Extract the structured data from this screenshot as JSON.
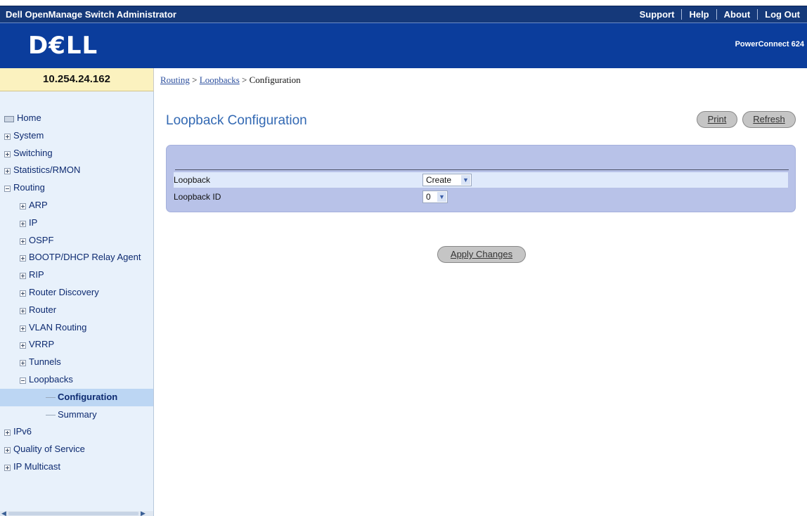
{
  "header": {
    "app_title": "Dell OpenManage Switch Administrator",
    "links": [
      "Support",
      "Help",
      "About",
      "Log Out"
    ],
    "logo_text": "D€LL",
    "product_text": "PowerConnect 624"
  },
  "sidebar": {
    "ip_address": "10.254.24.162",
    "items": [
      {
        "label": "Home"
      },
      {
        "label": "System"
      },
      {
        "label": "Switching"
      },
      {
        "label": "Statistics/RMON"
      },
      {
        "label": "Routing"
      },
      {
        "label": "ARP"
      },
      {
        "label": "IP"
      },
      {
        "label": "OSPF"
      },
      {
        "label": "BOOTP/DHCP Relay Agent"
      },
      {
        "label": "RIP"
      },
      {
        "label": "Router Discovery"
      },
      {
        "label": "Router"
      },
      {
        "label": "VLAN Routing"
      },
      {
        "label": "VRRP"
      },
      {
        "label": "Tunnels"
      },
      {
        "label": "Loopbacks"
      },
      {
        "label": "Configuration"
      },
      {
        "label": "Summary"
      },
      {
        "label": "IPv6"
      },
      {
        "label": "Quality of Service"
      },
      {
        "label": "IP Multicast"
      }
    ]
  },
  "breadcrumb": {
    "routing": "Routing",
    "sep1": " > ",
    "loopbacks": "Loopbacks",
    "sep2": " > ",
    "current": "Configuration"
  },
  "main": {
    "title": "Loopback Configuration",
    "print_label": "Print",
    "refresh_label": "Refresh",
    "form": {
      "loopback_label": "Loopback",
      "loopback_value": "Create",
      "loopback_id_label": "Loopback ID",
      "loopback_id_value": "0"
    },
    "apply_label": "Apply Changes"
  },
  "colors": {
    "title_bar": "#15397a",
    "brand_bar": "#0b3d9c",
    "sidebar_bg": "#e8f1fb",
    "ip_box_bg": "#fbf2bf",
    "panel_bg": "#b8c2e8",
    "title_text": "#3369b3"
  }
}
